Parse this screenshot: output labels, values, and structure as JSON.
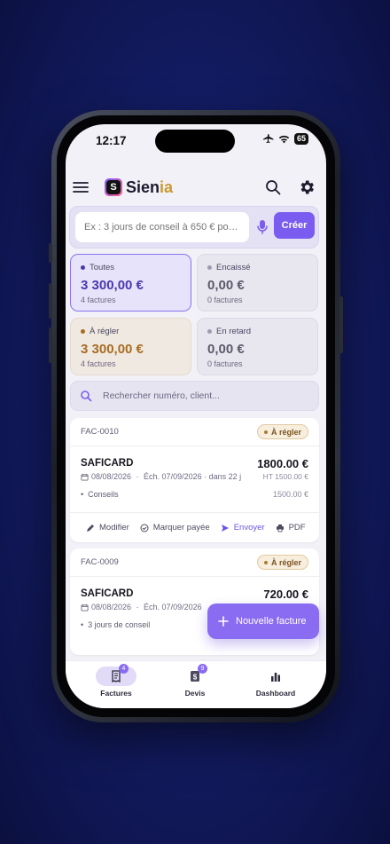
{
  "status_bar": {
    "time": "12:17",
    "battery": "65"
  },
  "app": {
    "brand_prefix": "Sien",
    "brand_suffix": "ia",
    "logo_letter": "S"
  },
  "composer": {
    "placeholder": "Ex : 3 jours de conseil à 650 € pou...",
    "create_label": "Créer"
  },
  "stats": [
    {
      "label": "Toutes",
      "amount": "3 300,00 €",
      "count": "4 factures",
      "dot_color": "#4b37b0"
    },
    {
      "label": "Encaissé",
      "amount": "0,00 €",
      "count": "0 factures",
      "dot_color": "#9e9bb0"
    },
    {
      "label": "À régler",
      "amount": "3 300,00 €",
      "count": "4 factures",
      "dot_color": "#a76c22"
    },
    {
      "label": "En retard",
      "amount": "0,00 €",
      "count": "0 factures",
      "dot_color": "#9e9bb0"
    }
  ],
  "search": {
    "placeholder": "Rechercher numéro, client..."
  },
  "invoices": [
    {
      "number": "FAC-0010",
      "status": "À régler",
      "client": "SAFICARD",
      "total": "1800.00 €",
      "date": "08/08/2026",
      "due": "Éch. 07/09/2026 · dans 22 j",
      "ht": "HT 1500.00 €",
      "item": "Conseils",
      "item_amount": "1500.00 €",
      "actions": {
        "edit": "Modifier",
        "mark_paid": "Marquer payée",
        "send": "Envoyer",
        "pdf": "PDF"
      }
    },
    {
      "number": "FAC-0009",
      "status": "À régler",
      "client": "SAFICARD",
      "total": "720.00 €",
      "date": "08/08/2026",
      "due": "Éch. 07/09/2026",
      "item": "3 jours de conseil"
    }
  ],
  "fab": {
    "label": "Nouvelle facture"
  },
  "tabs": [
    {
      "label": "Factures",
      "badge": "4",
      "icon": "receipt-icon"
    },
    {
      "label": "Devis",
      "badge": "9",
      "icon": "quote-icon"
    },
    {
      "label": "Dashboard",
      "icon": "bar-chart-icon"
    }
  ],
  "colors": {
    "accent": "#7b5cf0",
    "due": "#a76c22",
    "background": "#f2f1f7"
  }
}
